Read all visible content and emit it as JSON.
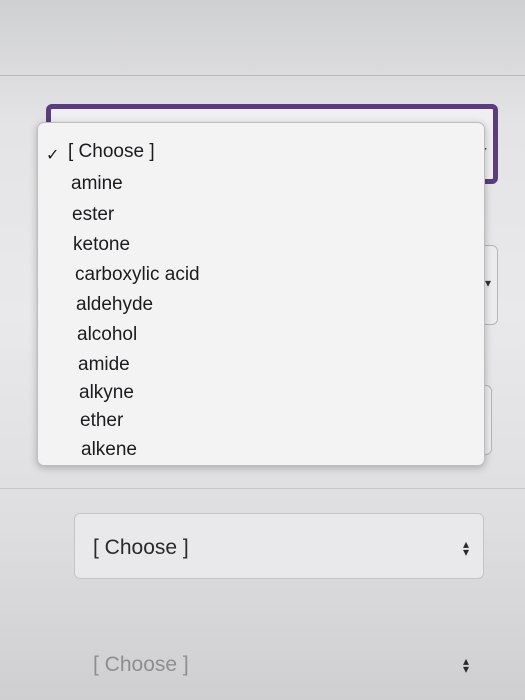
{
  "dropdown": {
    "selected_mark": "✓",
    "options": [
      "[ Choose ]",
      "amine",
      "ester",
      "ketone",
      "carboxylic acid",
      "aldehyde",
      "alcohol",
      "amide",
      "alkyne",
      "ether",
      "alkene"
    ]
  },
  "selects": [
    {
      "value": "[ Choose ]"
    },
    {
      "value": "[ Choose ]"
    }
  ],
  "colors": {
    "focus_border": "#5a3d7a",
    "menu_background": "#f3f3f4"
  },
  "icons": {
    "select_arrow": "up-down-chevron-icon",
    "check": "check-icon"
  }
}
